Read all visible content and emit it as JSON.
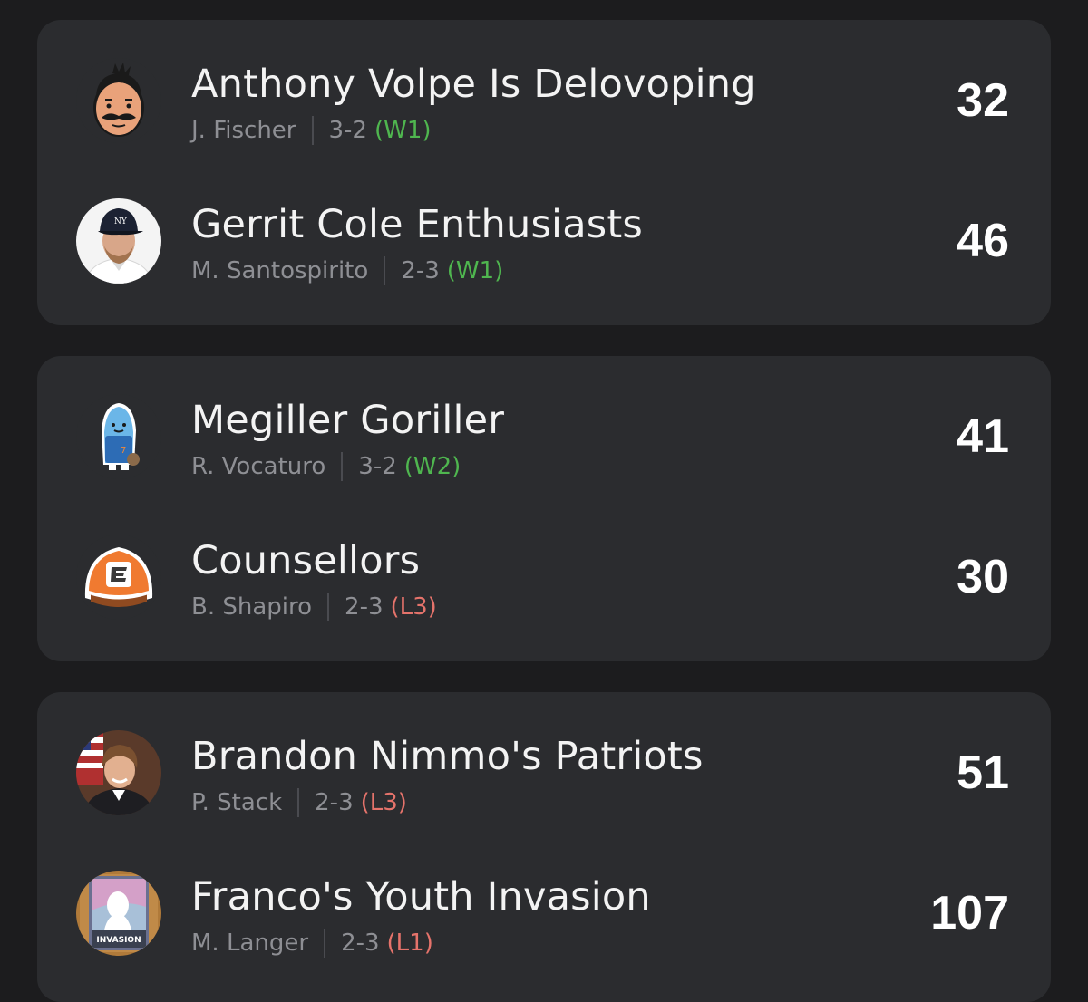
{
  "matchups": [
    {
      "teams": [
        {
          "name": "Anthony Volpe Is Delovoping",
          "owner": "J. Fischer",
          "record": "3-2",
          "streak": "(W1)",
          "streak_type": "win",
          "score": "32",
          "avatar_icon": "mustache-cartoon-avatar-icon"
        },
        {
          "name": "Gerrit Cole Enthusiasts",
          "owner": "M. Santospirito",
          "record": "2-3",
          "streak": "(W1)",
          "streak_type": "win",
          "score": "46",
          "avatar_icon": "player-photo-avatar-icon"
        }
      ]
    },
    {
      "teams": [
        {
          "name": "Megiller Goriller",
          "owner": "R. Vocaturo",
          "record": "3-2",
          "streak": "(W2)",
          "streak_type": "win",
          "score": "41",
          "avatar_icon": "baseball-mascot-avatar-icon"
        },
        {
          "name": "Counsellors",
          "owner": "B. Shapiro",
          "record": "2-3",
          "streak": "(L3)",
          "streak_type": "loss",
          "score": "30",
          "avatar_icon": "espn-cap-avatar-icon"
        }
      ]
    },
    {
      "teams": [
        {
          "name": "Brandon Nimmo's Patriots",
          "owner": "P. Stack",
          "record": "2-3",
          "streak": "(L3)",
          "streak_type": "loss",
          "score": "51",
          "avatar_icon": "patriot-photo-avatar-icon"
        },
        {
          "name": "Franco's Youth Invasion",
          "owner": "M. Langer",
          "record": "2-3",
          "streak": "(L1)",
          "streak_type": "loss",
          "score": "107",
          "avatar_icon": "youth-invasion-card-avatar-icon"
        }
      ]
    }
  ],
  "colors": {
    "background": "#1c1c1e",
    "card": "#2b2c2f",
    "win": "#4fb64f",
    "loss": "#e5736b"
  }
}
